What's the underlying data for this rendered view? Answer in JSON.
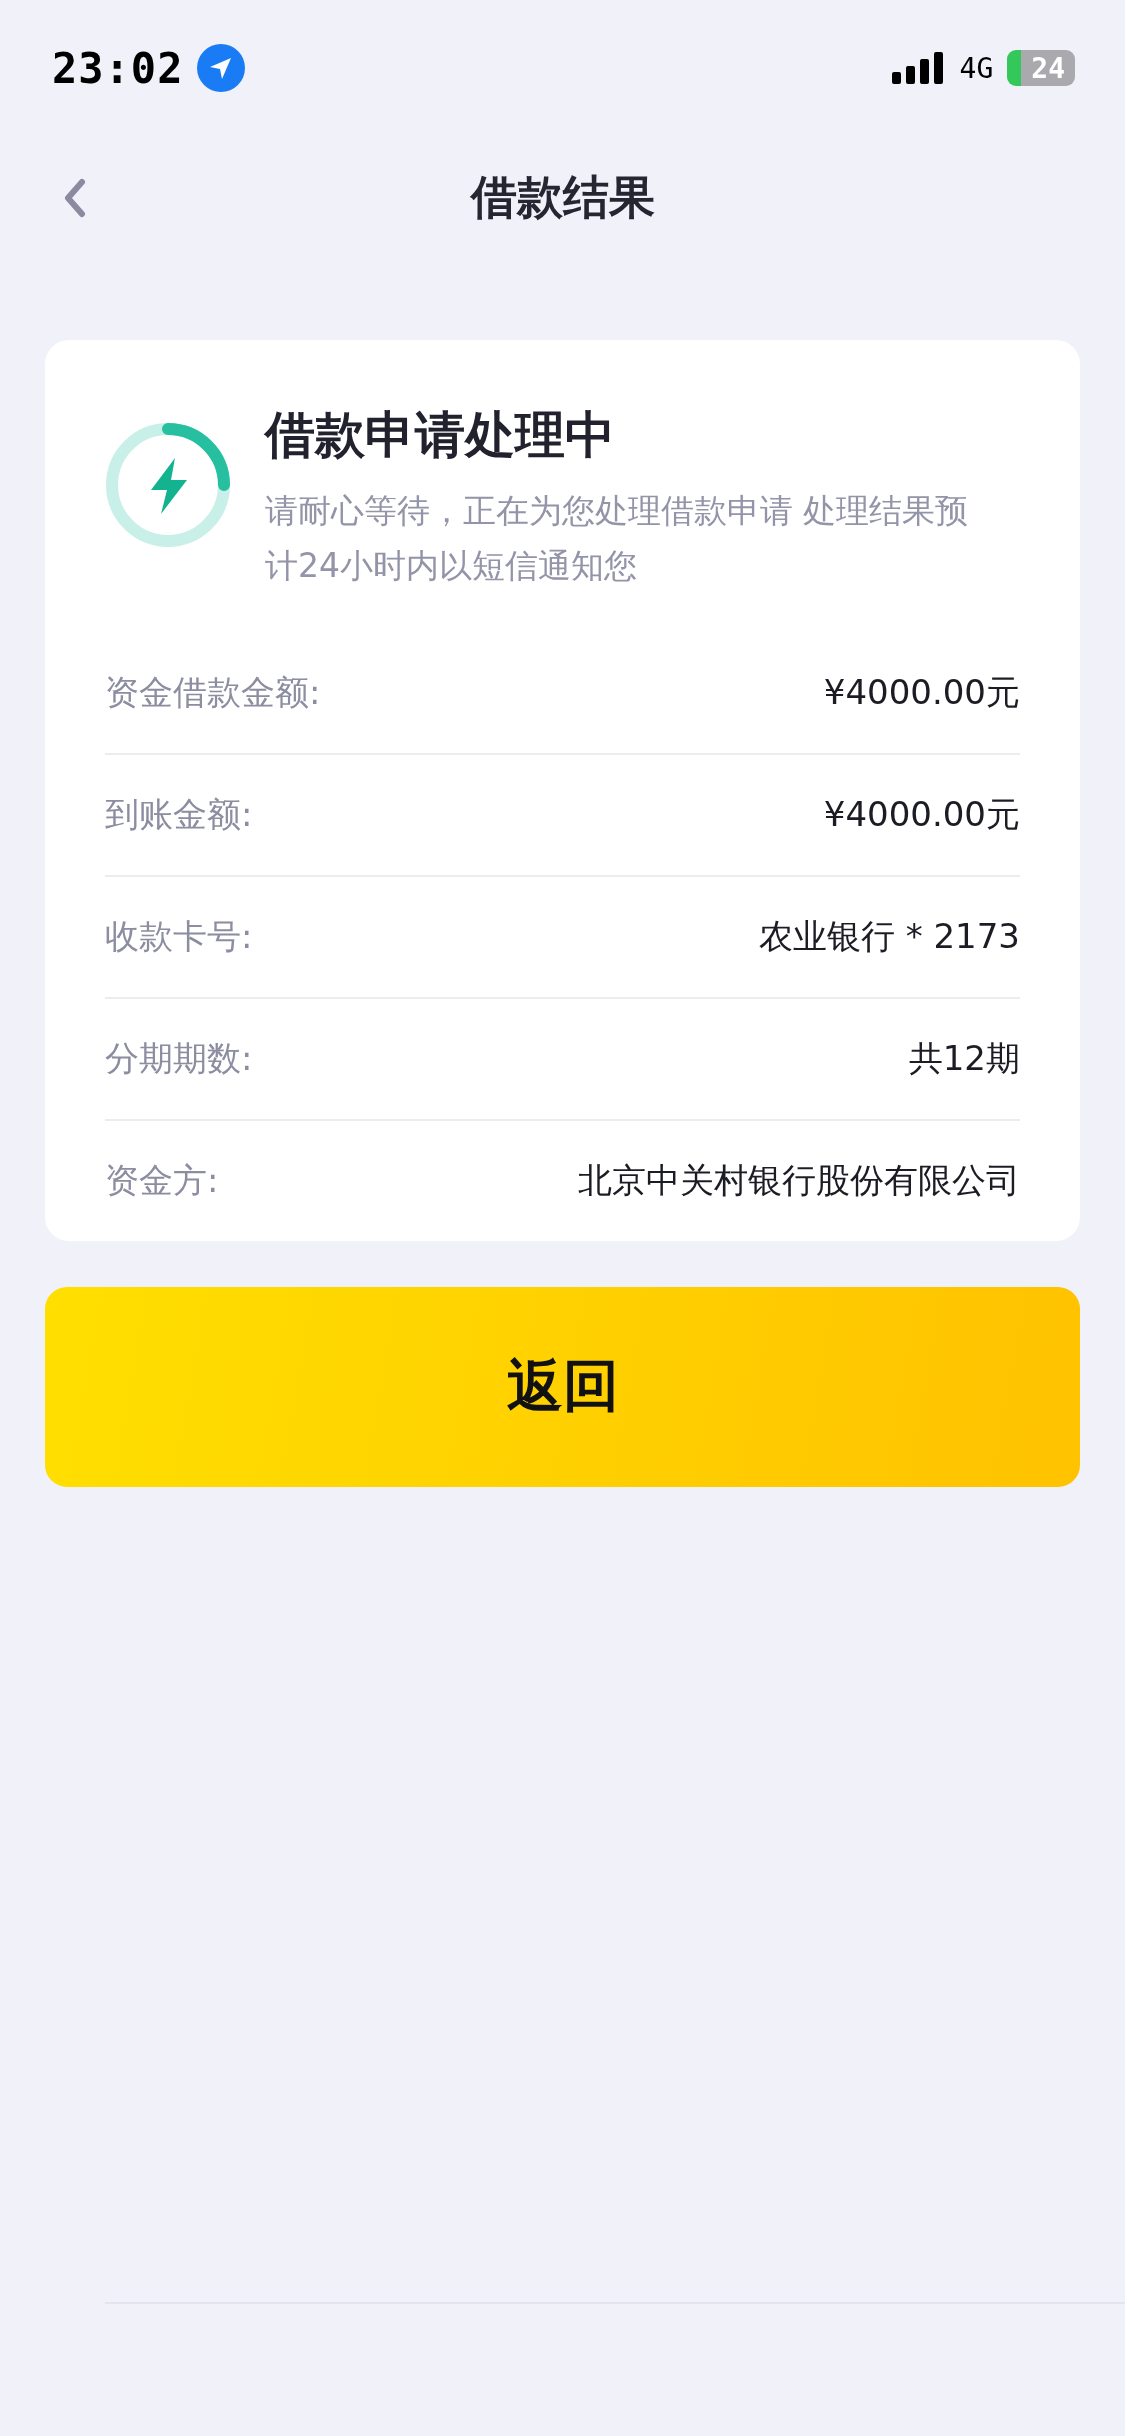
{
  "status_bar": {
    "time": "23:02",
    "network": "4G",
    "battery": "24"
  },
  "nav": {
    "title": "借款结果"
  },
  "status": {
    "title": "借款申请处理中",
    "description": "请耐心等待，正在为您处理借款申请 处理结果预计24小时内以短信通知您"
  },
  "details": [
    {
      "label": "资金借款金额:",
      "value": "¥4000.00元"
    },
    {
      "label": "到账金额:",
      "value": "¥4000.00元"
    },
    {
      "label": "收款卡号:",
      "value": "农业银行 * 2173"
    },
    {
      "label": "分期期数:",
      "value": "共12期"
    },
    {
      "label": "资金方:",
      "value": "北京中关村银行股份有限公司"
    }
  ],
  "button": {
    "label": "返回"
  }
}
